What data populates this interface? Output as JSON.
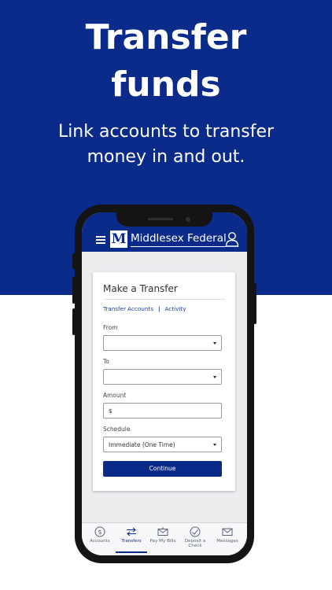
{
  "hero": {
    "title_line1": "Transfer",
    "title_line2": "funds",
    "subtitle_line1": "Link accounts to transfer",
    "subtitle_line2": "money in and out."
  },
  "app": {
    "brand": "Middlesex Federal",
    "logo_letter": "M"
  },
  "form": {
    "title": "Make a Transfer",
    "tabs": [
      "Transfer Accounts",
      "Activity"
    ],
    "tab_separator": "|",
    "from_label": "From",
    "from_value": "",
    "to_label": "To",
    "to_value": "",
    "amount_label": "Amount",
    "amount_value": "$",
    "schedule_label": "Schedule",
    "schedule_value": "Immediate (One Time)",
    "continue_label": "Continue"
  },
  "nav": {
    "items": [
      {
        "label": "Accounts",
        "icon": "dollar-circle-icon"
      },
      {
        "label": "Transfers",
        "icon": "transfer-arrows-icon",
        "active": true
      },
      {
        "label": "Pay My Bills",
        "icon": "envelope-icon"
      },
      {
        "label": "Deposit a Check",
        "icon": "check-deposit-icon"
      },
      {
        "label": "Messages",
        "icon": "mail-icon"
      }
    ]
  },
  "colors": {
    "brand_blue": "#0a2b8a",
    "background": "#ffffff"
  }
}
